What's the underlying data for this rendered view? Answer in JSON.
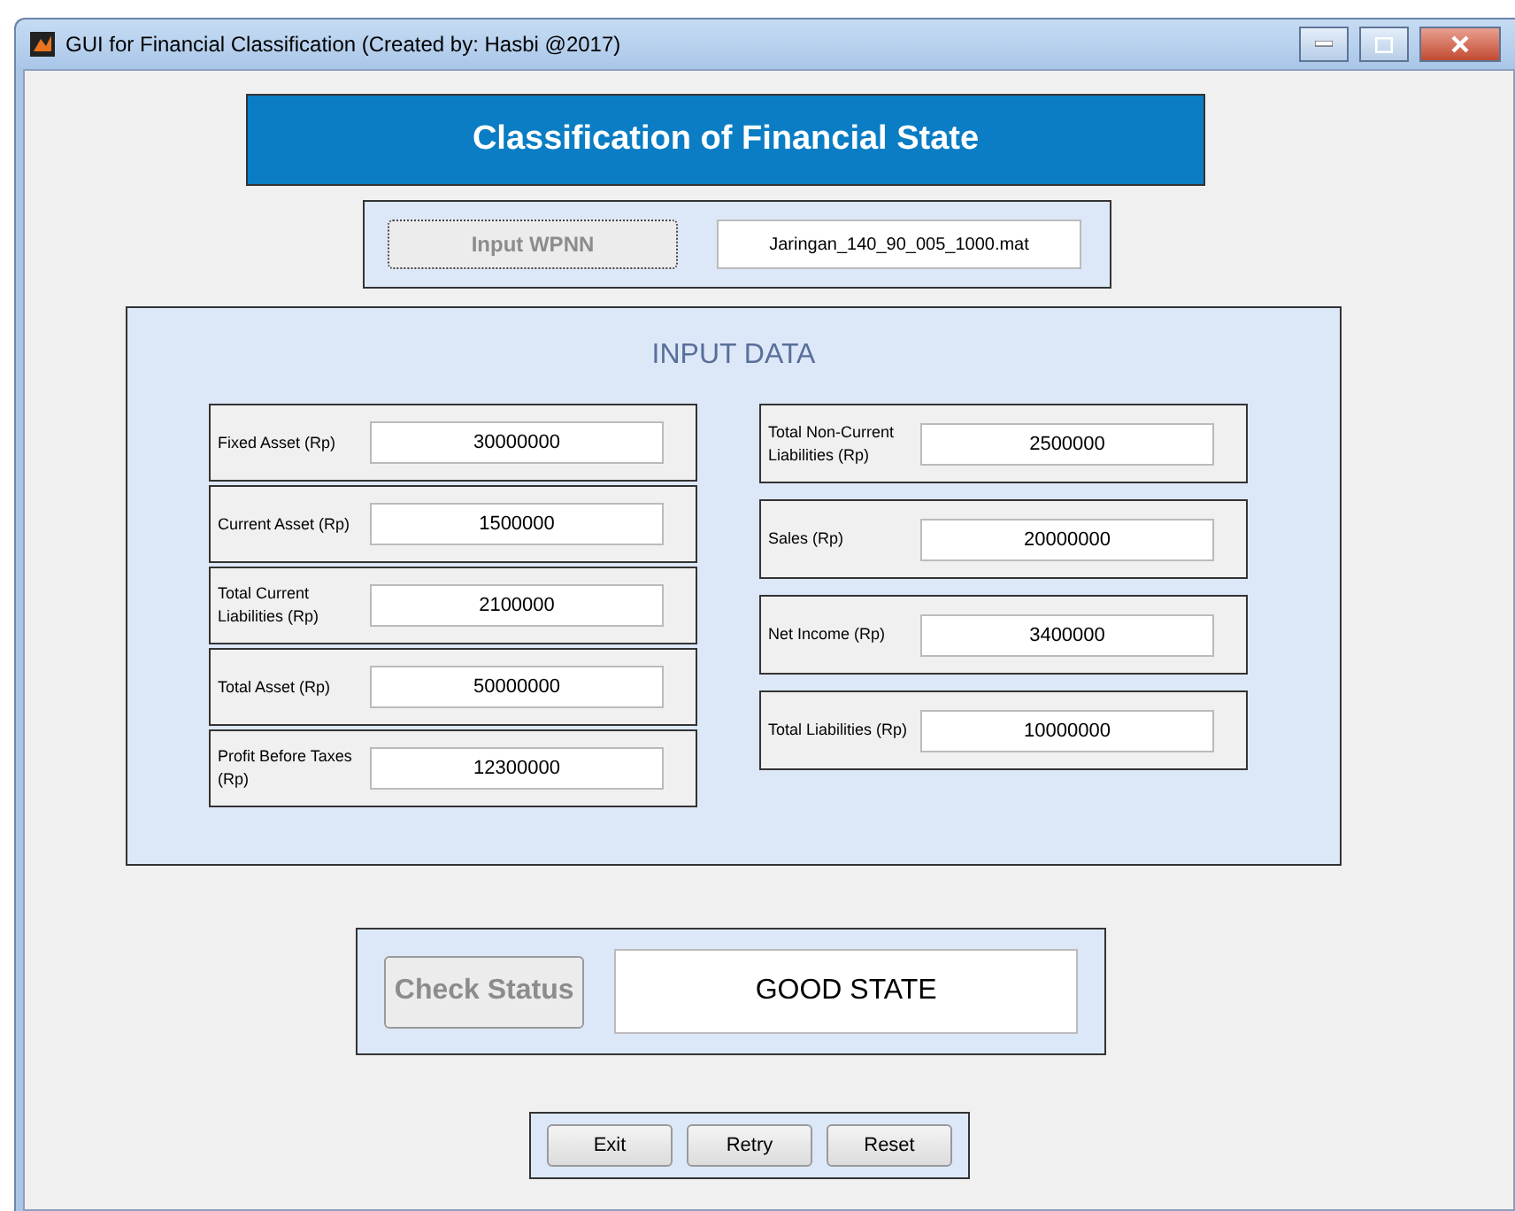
{
  "window": {
    "title": "GUI for Financial Classification (Created by: Hasbi @2017)"
  },
  "header": {
    "title": "Classification of Financial State"
  },
  "network": {
    "button": {
      "label": "Input WPNN",
      "disabled": true
    },
    "file": "Jaringan_140_90_005_1000.mat"
  },
  "input_data": {
    "title": "INPUT DATA",
    "left_fields": [
      {
        "label": "Fixed Asset (Rp)",
        "value": "30000000"
      },
      {
        "label": "Current Asset (Rp)",
        "value": "1500000"
      },
      {
        "label": "Total Current Liabilities (Rp)",
        "value": "2100000"
      },
      {
        "label": "Total Asset (Rp)",
        "value": "50000000"
      },
      {
        "label": "Profit Before Taxes (Rp)",
        "value": "12300000"
      }
    ],
    "right_fields": [
      {
        "label": "Total Non-Current Liabilities (Rp)",
        "value": "2500000"
      },
      {
        "label": "Sales (Rp)",
        "value": "20000000"
      },
      {
        "label": "Net Income (Rp)",
        "value": "3400000"
      },
      {
        "label": "Total Liabilities (Rp)",
        "value": "10000000"
      }
    ]
  },
  "status": {
    "button": {
      "label": "Check Status",
      "disabled": true
    },
    "result": "GOOD STATE"
  },
  "buttons": [
    "Exit",
    "Retry",
    "Reset"
  ]
}
